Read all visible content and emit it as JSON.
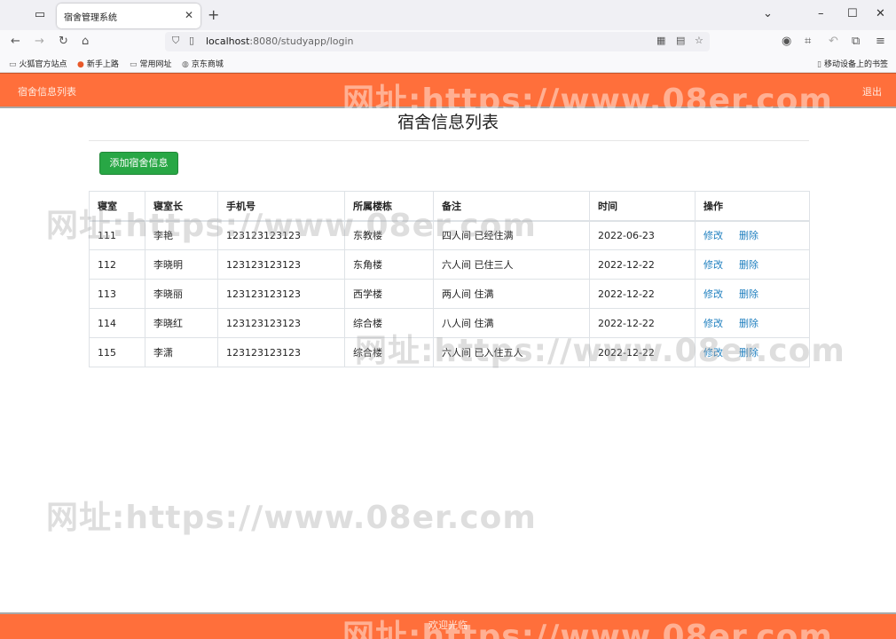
{
  "browser": {
    "tab_title": "宿舍管理系统",
    "url_host": "localhost",
    "url_rest": ":8080/studyapp/login",
    "bookmarks": [
      "火狐官方站点",
      "新手上路",
      "常用网址",
      "京东商城"
    ],
    "mobile_bookmarks": "移动设备上的书签"
  },
  "header": {
    "brand": "宿舍信息列表",
    "logout": "退出"
  },
  "main": {
    "title": "宿舍信息列表",
    "add_button": "添加宿舍信息",
    "columns": [
      "寝室",
      "寝室长",
      "手机号",
      "所属楼栋",
      "备注",
      "时间",
      "操作"
    ],
    "edit_label": "修改",
    "delete_label": "删除",
    "rows": [
      [
        "111",
        "李艳",
        "123123123123",
        "东教楼",
        "四人间 已经住满",
        "2022-06-23"
      ],
      [
        "112",
        "李晓明",
        "123123123123",
        "东角楼",
        "六人间 已住三人",
        "2022-12-22"
      ],
      [
        "113",
        "李晓丽",
        "123123123123",
        "西学楼",
        "两人间 住满",
        "2022-12-22"
      ],
      [
        "114",
        "李晓红",
        "123123123123",
        "综合楼",
        "八人间 住满",
        "2022-12-22"
      ],
      [
        "115",
        "李潇",
        "123123123123",
        "综合楼",
        "六人间 已入住五人",
        "2022-12-22"
      ]
    ]
  },
  "footer": {
    "text": "欢迎光临"
  },
  "watermark": "网址:https://www.08er.com",
  "colors": {
    "header_bg": "#ff6f3b",
    "add_button_bg": "#28a745",
    "link": "#1f7fbf"
  }
}
